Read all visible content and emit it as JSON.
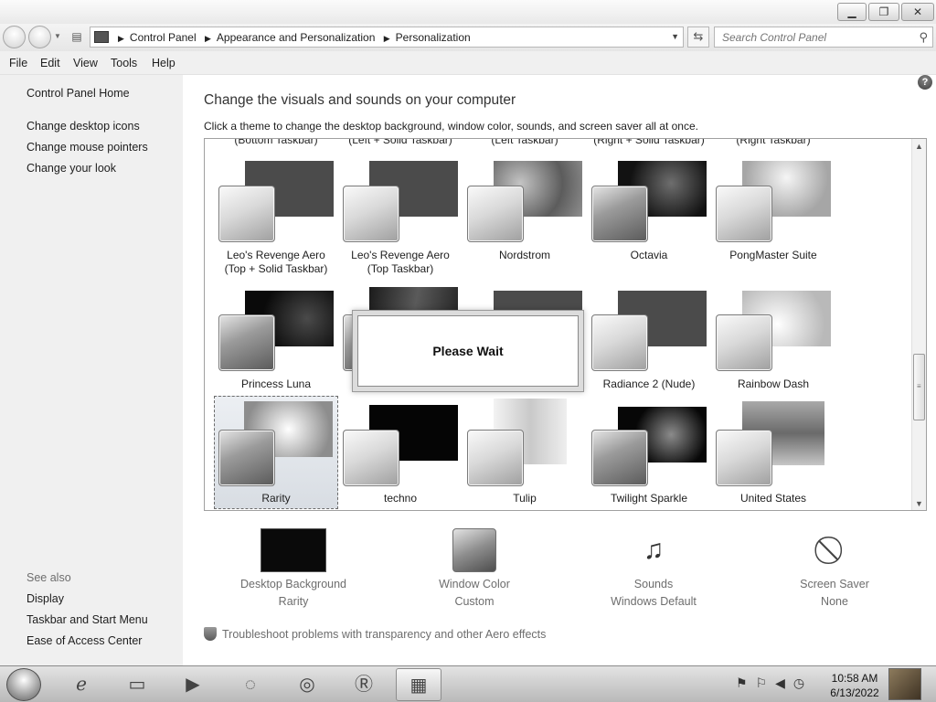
{
  "navigation": {
    "breadcrumbs": [
      "Control Panel",
      "Appearance and Personalization",
      "Personalization"
    ],
    "search_placeholder": "Search Control Panel"
  },
  "menu": [
    "File",
    "Edit",
    "View",
    "Tools",
    "Help"
  ],
  "sidebar": {
    "home": "Control Panel Home",
    "links": [
      "Change desktop icons",
      "Change mouse pointers",
      "Change your look"
    ],
    "see_also_label": "See also",
    "see_also": [
      "Display",
      "Taskbar and Start Menu",
      "Ease of Access Center"
    ]
  },
  "main": {
    "title": "Change the visuals and sounds on your computer",
    "subtitle": "Click a theme to change the desktop background, window color, sounds, and screen saver all at once.",
    "cutoff_labels": [
      "(Bottom Taskbar)",
      "(Left + Solid Taskbar)",
      "(Left Taskbar)",
      "(Right + Solid Taskbar)",
      "(Right Taskbar)"
    ],
    "themes": [
      {
        "name": "Leo's Revenge Aero",
        "name2": "(Top + Solid Taskbar)"
      },
      {
        "name": "Leo's Revenge Aero",
        "name2": "(Top Taskbar)"
      },
      {
        "name": "Nordstrom",
        "name2": ""
      },
      {
        "name": "Octavia",
        "name2": ""
      },
      {
        "name": "PongMaster Suite",
        "name2": ""
      },
      {
        "name": "Princess Luna",
        "name2": ""
      },
      {
        "name": "",
        "name2": ""
      },
      {
        "name": "",
        "name2": ""
      },
      {
        "name": "Radiance 2 (Nude)",
        "name2": ""
      },
      {
        "name": "Rainbow Dash",
        "name2": ""
      },
      {
        "name": "Rarity",
        "name2": "",
        "selected": true
      },
      {
        "name": "techno",
        "name2": ""
      },
      {
        "name": "Tulip",
        "name2": ""
      },
      {
        "name": "Twilight Sparkle",
        "name2": ""
      },
      {
        "name": "United States",
        "name2": ""
      }
    ],
    "wait_dialog": "Please Wait",
    "settings": [
      {
        "label": "Desktop Background",
        "value": "Rarity"
      },
      {
        "label": "Window Color",
        "value": "Custom"
      },
      {
        "label": "Sounds",
        "value": "Windows Default"
      },
      {
        "label": "Screen Saver",
        "value": "None"
      }
    ],
    "troubleshoot": "Troubleshoot problems with transparency and other Aero effects"
  },
  "taskbar": {
    "time": "10:58 AM",
    "date": "6/13/2022"
  }
}
